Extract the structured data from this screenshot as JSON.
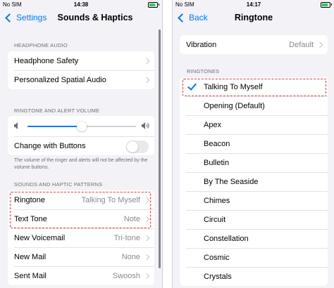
{
  "left": {
    "status": {
      "carrier": "No SIM",
      "time": "14:38"
    },
    "nav": {
      "back": "Settings",
      "title": "Sounds & Haptics"
    },
    "headphone": {
      "header": "HEADPHONE AUDIO",
      "rows": [
        {
          "label": "Headphone Safety"
        },
        {
          "label": "Personalized Spatial Audio"
        }
      ]
    },
    "volume": {
      "header": "RINGTONE AND ALERT VOLUME",
      "level": 0.5,
      "change_label": "Change with Buttons",
      "change_on": false,
      "footnote": "The volume of the ringer and alerts will not be affected by the volume buttons."
    },
    "patterns": {
      "header": "SOUNDS AND HAPTIC PATTERNS",
      "rows": [
        {
          "label": "Ringtone",
          "value": "Talking To Myself"
        },
        {
          "label": "Text Tone",
          "value": "Note"
        },
        {
          "label": "New Voicemail",
          "value": "Tri-tone"
        },
        {
          "label": "New Mail",
          "value": "None"
        },
        {
          "label": "Sent Mail",
          "value": "Swoosh"
        }
      ]
    }
  },
  "right": {
    "status": {
      "carrier": "No SIM",
      "time": "14:17"
    },
    "nav": {
      "back": "Back",
      "title": "Ringtone"
    },
    "vibration": {
      "label": "Vibration",
      "value": "Default"
    },
    "ringtones": {
      "header": "RINGTONES",
      "selected": "Talking To Myself",
      "items": [
        "Talking To Myself",
        "Opening (Default)",
        "Apex",
        "Beacon",
        "Bulletin",
        "By The Seaside",
        "Chimes",
        "Circuit",
        "Constellation",
        "Cosmic",
        "Crystals"
      ]
    }
  },
  "colors": {
    "accent": "#007aff",
    "highlight": "#e53935",
    "battery": "#34c759"
  },
  "icons": [
    "chevron-left-icon",
    "chevron-right-icon",
    "speaker-low-icon",
    "speaker-high-icon",
    "checkmark-icon",
    "battery-icon"
  ]
}
